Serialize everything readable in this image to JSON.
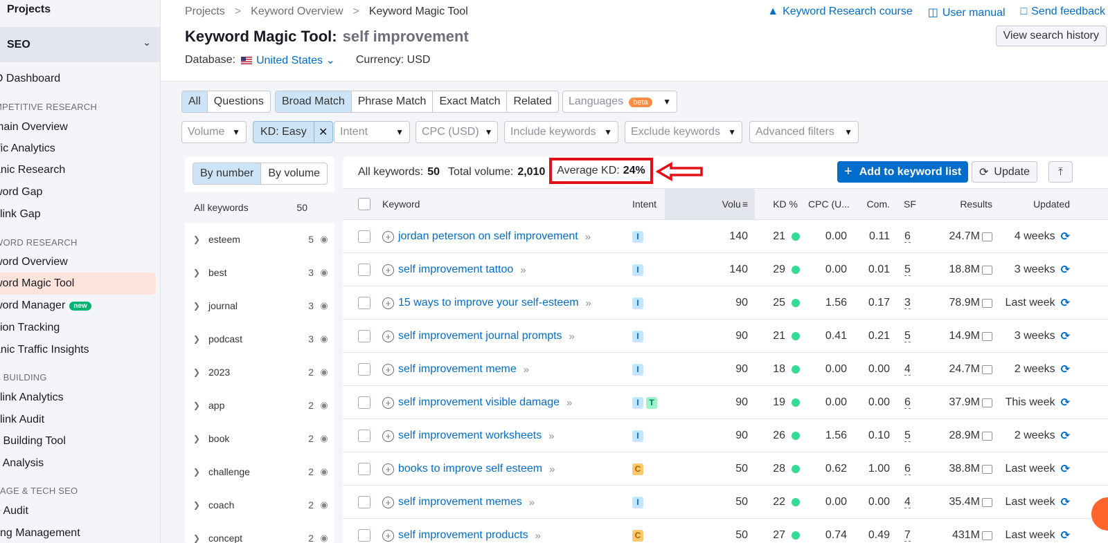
{
  "sidebar": {
    "projects": "Projects",
    "seo": "SEO",
    "items": [
      {
        "label": "O Dashboard",
        "type": "item"
      },
      {
        "label": "MPETITIVE RESEARCH",
        "type": "section"
      },
      {
        "label": "main Overview",
        "type": "item"
      },
      {
        "label": "ffic Analytics",
        "type": "item"
      },
      {
        "label": "anic Research",
        "type": "item"
      },
      {
        "label": "word Gap",
        "type": "item"
      },
      {
        "label": "klink Gap",
        "type": "item"
      },
      {
        "label": "WORD RESEARCH",
        "type": "section"
      },
      {
        "label": "word Overview",
        "type": "item"
      },
      {
        "label": "word Magic Tool",
        "type": "item",
        "active": true
      },
      {
        "label": "word Manager",
        "type": "item",
        "badge": "new"
      },
      {
        "label": "ition Tracking",
        "type": "item"
      },
      {
        "label": "anic Traffic Insights",
        "type": "item"
      },
      {
        "label": "K BUILDING",
        "type": "section"
      },
      {
        "label": "klink Analytics",
        "type": "item"
      },
      {
        "label": "klink Audit",
        "type": "item"
      },
      {
        "label": "k Building Tool",
        "type": "item"
      },
      {
        "label": "k Analysis",
        "type": "item"
      },
      {
        "label": "PAGE & TECH SEO",
        "type": "section"
      },
      {
        "label": "e Audit",
        "type": "item"
      },
      {
        "label": "ting Management",
        "type": "item"
      }
    ]
  },
  "header": {
    "breadcrumbs": [
      "Projects",
      "Keyword Overview",
      "Keyword Magic Tool"
    ],
    "links": [
      "Keyword Research course",
      "User manual",
      "Send feedback"
    ],
    "title": "Keyword Magic Tool:",
    "query": "self improvement",
    "history_btn": "View search history",
    "database_label": "Database:",
    "database_value": "United States",
    "currency": "Currency: USD"
  },
  "filters": {
    "type_tabs": [
      "All",
      "Questions"
    ],
    "match_tabs": [
      "Broad Match",
      "Phrase Match",
      "Exact Match",
      "Related"
    ],
    "languages": "Languages",
    "beta": "beta",
    "volume": "Volume",
    "kd": "KD: Easy",
    "intent": "Intent",
    "cpc": "CPC (USD)",
    "include": "Include keywords",
    "exclude": "Exclude keywords",
    "advanced": "Advanced filters"
  },
  "groups": {
    "toggle": [
      "By number",
      "By volume"
    ],
    "all_label": "All keywords",
    "all_count": "50",
    "rows": [
      {
        "name": "esteem",
        "count": "5"
      },
      {
        "name": "best",
        "count": "3"
      },
      {
        "name": "journal",
        "count": "3"
      },
      {
        "name": "podcast",
        "count": "3"
      },
      {
        "name": "2023",
        "count": "2"
      },
      {
        "name": "app",
        "count": "2"
      },
      {
        "name": "book",
        "count": "2"
      },
      {
        "name": "challenge",
        "count": "2"
      },
      {
        "name": "coach",
        "count": "2"
      },
      {
        "name": "concept",
        "count": "2"
      }
    ]
  },
  "stats": {
    "all_label": "All keywords:",
    "all_value": "50",
    "vol_label": "Total volume:",
    "vol_value": "2,010",
    "kd_label": "Average KD:",
    "kd_value": "24%"
  },
  "actions": {
    "add": "Add to keyword list",
    "update": "Update"
  },
  "table": {
    "headers": {
      "keyword": "Keyword",
      "intent": "Intent",
      "volume": "Volu",
      "kd": "KD %",
      "cpc": "CPC (U...",
      "com": "Com.",
      "sf": "SF",
      "results": "Results",
      "updated": "Updated"
    },
    "rows": [
      {
        "keyword": "jordan peterson on self improvement",
        "intent": [
          "I"
        ],
        "volume": "140",
        "kd": "21",
        "cpc": "0.00",
        "com": "0.11",
        "sf": "6",
        "results": "24.7M",
        "updated": "4 weeks"
      },
      {
        "keyword": "self improvement tattoo",
        "intent": [
          "I"
        ],
        "volume": "140",
        "kd": "29",
        "cpc": "0.00",
        "com": "0.01",
        "sf": "5",
        "results": "18.8M",
        "updated": "3 weeks"
      },
      {
        "keyword": "15 ways to improve your self-esteem",
        "intent": [
          "I"
        ],
        "volume": "90",
        "kd": "25",
        "cpc": "1.56",
        "com": "0.17",
        "sf": "3",
        "results": "78.9M",
        "updated": "Last week"
      },
      {
        "keyword": "self improvement journal prompts",
        "intent": [
          "I"
        ],
        "volume": "90",
        "kd": "21",
        "cpc": "0.41",
        "com": "0.21",
        "sf": "5",
        "results": "14.9M",
        "updated": "3 weeks"
      },
      {
        "keyword": "self improvement meme",
        "intent": [
          "I"
        ],
        "volume": "90",
        "kd": "18",
        "cpc": "0.00",
        "com": "0.00",
        "sf": "4",
        "results": "24.7M",
        "updated": "2 weeks"
      },
      {
        "keyword": "self improvement visible damage",
        "intent": [
          "I",
          "T"
        ],
        "volume": "90",
        "kd": "19",
        "cpc": "0.00",
        "com": "0.00",
        "sf": "6",
        "results": "37.9M",
        "updated": "This week"
      },
      {
        "keyword": "self improvement worksheets",
        "intent": [
          "I"
        ],
        "volume": "90",
        "kd": "26",
        "cpc": "1.56",
        "com": "0.10",
        "sf": "5",
        "results": "28.9M",
        "updated": "2 weeks"
      },
      {
        "keyword": "books to improve self esteem",
        "intent": [
          "C"
        ],
        "volume": "50",
        "kd": "28",
        "cpc": "0.62",
        "com": "1.00",
        "sf": "6",
        "results": "38.8M",
        "updated": "Last week"
      },
      {
        "keyword": "self improvement memes",
        "intent": [
          "I"
        ],
        "volume": "50",
        "kd": "22",
        "cpc": "0.00",
        "com": "0.00",
        "sf": "4",
        "results": "35.4M",
        "updated": "Last week"
      },
      {
        "keyword": "self improvement products",
        "intent": [
          "C"
        ],
        "volume": "50",
        "kd": "27",
        "cpc": "0.74",
        "com": "0.49",
        "sf": "7",
        "results": "431M",
        "updated": "Last week"
      }
    ]
  },
  "colors": {
    "accent": "#006dca",
    "highlight": "#e30f17",
    "kd_easy": "#36d994"
  }
}
